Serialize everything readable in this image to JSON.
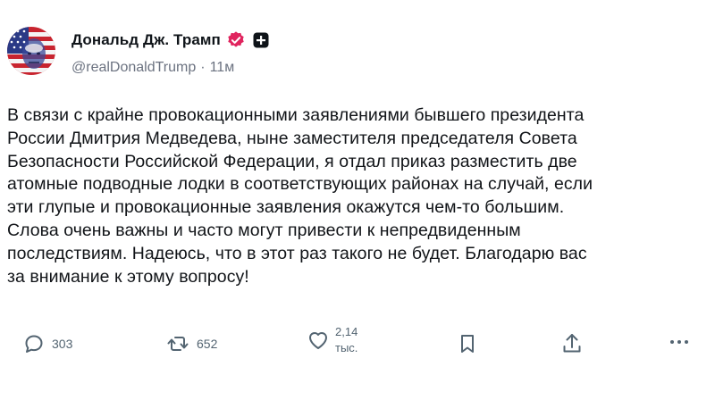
{
  "author": {
    "display_name": "Дональд Дж. Трамп",
    "handle": "@realDonaldTrump",
    "separator": "·",
    "time": "11м",
    "avatar_icon": "flag-portrait-avatar",
    "verified_icon": "verified-badge-icon",
    "plus_icon": "plus-badge-icon"
  },
  "post": {
    "lines": [
      "В связи с крайне провокационными заявлениями бывшего президента",
      "России Дмитрия Медведева, ныне заместителя председателя Совета",
      "Безопасности Российской Федерации, я отдал приказ разместить две",
      "атомные подводные лодки в соответствующих районах на случай, если",
      "эти глупые и провокационные заявления окажутся чем-то большим.",
      "Слова очень важны и часто могут привести к непредвиденным",
      "последствиям. Надеюсь, что в этот раз такого не будет. Благодарю вас",
      "за внимание к этому вопросу!"
    ]
  },
  "actions": {
    "replies": "303",
    "reposts": "652",
    "likes_line1": "2,14",
    "likes_line2": "тыс.",
    "icons": [
      "reply-icon",
      "repost-icon",
      "like-icon",
      "bookmark-icon",
      "share-icon",
      "more-icon"
    ]
  },
  "colors": {
    "verified": "#e0245e",
    "text": "#0f1419",
    "muted": "#536471"
  }
}
